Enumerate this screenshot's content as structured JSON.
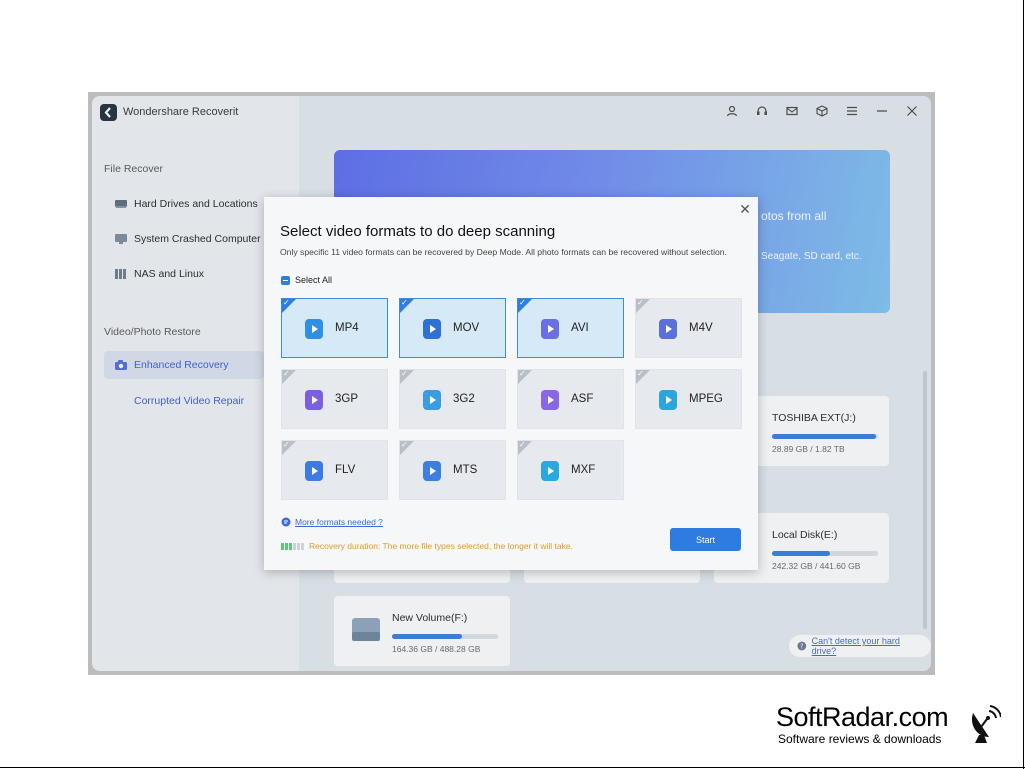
{
  "app": {
    "title": "Wondershare Recoverit"
  },
  "sidebar": {
    "section_file_recover": "File Recover",
    "items": [
      {
        "label": "Hard Drives and Locations",
        "icon": "hard-drive-icon"
      },
      {
        "label": "System Crashed Computer",
        "icon": "monitor-icon"
      },
      {
        "label": "NAS and Linux",
        "icon": "nas-icon"
      }
    ],
    "section_video_photo": "Video/Photo Restore",
    "enhanced_recovery": "Enhanced Recovery",
    "corrupted_video_repair": "Corrupted Video Repair"
  },
  "topbar": {
    "icons": [
      "user-icon",
      "headset-icon",
      "mail-icon",
      "box-icon",
      "menu-icon",
      "minimize-icon",
      "close-icon"
    ]
  },
  "banner": {
    "line1": "otos from all",
    "line2": "Seagate, SD card, etc."
  },
  "drives": [
    {
      "name": "TOSHIBA EXT(J:)",
      "size": "28.89 GB / 1.82 TB",
      "used_fraction": 0.98
    },
    {
      "name": "Local Disk(E:)",
      "size": "242.32 GB / 441.60 GB",
      "used_fraction": 0.55
    },
    {
      "name": "New Volume(F:)",
      "size": "164.36 GB / 488.28 GB",
      "used_fraction": 0.66
    }
  ],
  "cant_detect": "Can't detect your hard drive?",
  "dialog": {
    "title": "Select video formats to do deep scanning",
    "description": "Only specific 11 video formats can be recovered by Deep Mode. All photo formats can be recovered without selection.",
    "select_all": "Select All",
    "formats": [
      {
        "label": "MP4",
        "selected": true,
        "color": "#2f8ee6"
      },
      {
        "label": "MOV",
        "selected": true,
        "color": "#2f6fd6"
      },
      {
        "label": "AVI",
        "selected": true,
        "color": "#6a6fe6"
      },
      {
        "label": "M4V",
        "selected": false,
        "color": "#5b6fd9"
      },
      {
        "label": "3GP",
        "selected": false,
        "color": "#7b5fe0"
      },
      {
        "label": "3G2",
        "selected": false,
        "color": "#3b9de0"
      },
      {
        "label": "ASF",
        "selected": false,
        "color": "#8a66e8"
      },
      {
        "label": "MPEG",
        "selected": false,
        "color": "#2aa7d8"
      },
      {
        "label": "FLV",
        "selected": false,
        "color": "#3d7be0"
      },
      {
        "label": "MTS",
        "selected": false,
        "color": "#3c7fe0"
      },
      {
        "label": "MXF",
        "selected": false,
        "color": "#2aa9df"
      }
    ],
    "more_formats": "More formats needed ?",
    "duration_text": "Recovery duration: The more file types selected, the longer it will take.",
    "start": "Start"
  },
  "watermark": {
    "name": "SoftRadar.com",
    "tagline": "Software reviews & downloads"
  }
}
